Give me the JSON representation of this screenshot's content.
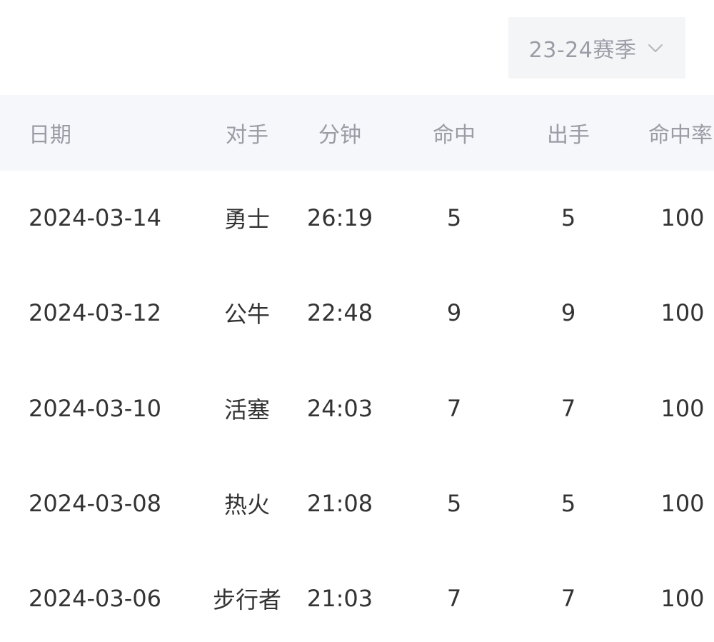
{
  "season_select": {
    "label": "23-24赛季",
    "icon": "chevron-down-icon"
  },
  "table": {
    "headers": {
      "date": "日期",
      "opponent": "对手",
      "minutes": "分钟",
      "made": "命中",
      "attempts": "出手",
      "pct": "命中率"
    },
    "rows": [
      {
        "date": "2024-03-14",
        "opponent": "勇士",
        "minutes": "26:19",
        "made": "5",
        "attempts": "5",
        "pct": "100"
      },
      {
        "date": "2024-03-12",
        "opponent": "公牛",
        "minutes": "22:48",
        "made": "9",
        "attempts": "9",
        "pct": "100"
      },
      {
        "date": "2024-03-10",
        "opponent": "活塞",
        "minutes": "24:03",
        "made": "7",
        "attempts": "7",
        "pct": "100"
      },
      {
        "date": "2024-03-08",
        "opponent": "热火",
        "minutes": "21:08",
        "made": "5",
        "attempts": "5",
        "pct": "100"
      },
      {
        "date": "2024-03-06",
        "opponent": "步行者",
        "minutes": "21:03",
        "made": "7",
        "attempts": "7",
        "pct": "100"
      }
    ]
  }
}
